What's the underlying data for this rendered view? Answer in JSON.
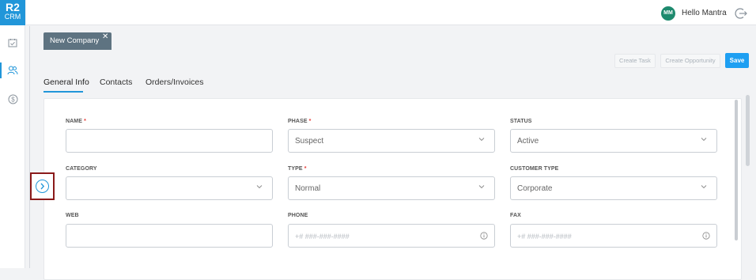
{
  "app": {
    "logo_line1": "R2",
    "logo_line2": "CRM",
    "accent_color": "#2196d9"
  },
  "sidebar": {
    "items": [
      {
        "name": "tasks",
        "icon": "calendar-check-icon"
      },
      {
        "name": "contacts",
        "icon": "users-icon",
        "active": true
      },
      {
        "name": "finance",
        "icon": "dollar-circle-icon"
      }
    ]
  },
  "header": {
    "avatar_initials": "MM",
    "greeting": "Hello Mantra",
    "logout_icon": "logout-icon"
  },
  "page_tab": {
    "label": "New Company",
    "close": "✕"
  },
  "toolbar": {
    "create_task": "Create Task",
    "create_opportunity": "Create Opportunity",
    "save": "Save"
  },
  "tabs": [
    "General Info",
    "Contacts",
    "Orders/Invoices"
  ],
  "form": {
    "name": {
      "label": "NAME",
      "required": "*",
      "value": ""
    },
    "phase": {
      "label": "PHASE",
      "required": "*",
      "value": "Suspect"
    },
    "status": {
      "label": "STATUS",
      "value": "Active"
    },
    "category": {
      "label": "CATEGORY",
      "value": ""
    },
    "type": {
      "label": "TYPE",
      "required": "*",
      "value": "Normal"
    },
    "customer_type": {
      "label": "CUSTOMER TYPE",
      "value": "Corporate"
    },
    "web": {
      "label": "WEB",
      "value": ""
    },
    "phone": {
      "label": "PHONE",
      "placeholder": "+# ###-###-####"
    },
    "fax": {
      "label": "FAX",
      "placeholder": "+# ###-###-####"
    }
  }
}
